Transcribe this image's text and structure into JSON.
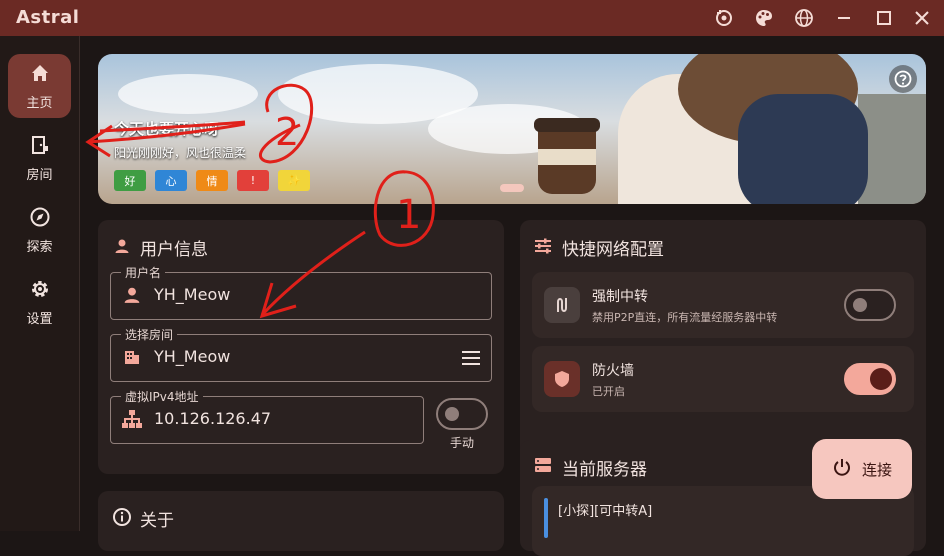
{
  "app": {
    "title": "Astral"
  },
  "titlebar_icons": [
    "sync-icon",
    "palette-icon",
    "globe-icon",
    "minimize-icon",
    "maximize-icon",
    "close-icon"
  ],
  "sidebar": {
    "items": [
      {
        "label": "主页",
        "icon": "home-icon",
        "active": true
      },
      {
        "label": "房间",
        "icon": "room-icon",
        "active": false
      },
      {
        "label": "探索",
        "icon": "compass-icon",
        "active": false
      },
      {
        "label": "设置",
        "icon": "gear-icon",
        "active": false
      }
    ]
  },
  "banner": {
    "title": "今天也要开心呀",
    "subtitle": "阳光刚刚好，风也很温柔",
    "chips": [
      {
        "text": "好",
        "color": "#3f9d43"
      },
      {
        "text": "心",
        "color": "#2f86d6"
      },
      {
        "text": "情",
        "color": "#ef8a16"
      },
      {
        "text": "!",
        "color": "#e2403a"
      },
      {
        "text": "✨",
        "color": "#f1d53a"
      }
    ]
  },
  "user_info": {
    "title": "用户信息",
    "username": {
      "label": "用户名",
      "value": "YH_Meow"
    },
    "room": {
      "label": "选择房间",
      "value": "YH_Meow"
    },
    "ipv4": {
      "label": "虚拟IPv4地址",
      "value": "10.126.126.47"
    },
    "manual_label": "手动"
  },
  "quick_config": {
    "title": "快捷网络配置",
    "options": [
      {
        "title": "强制中转",
        "desc": "禁用P2P直连，所有流量经服务器中转",
        "enabled": false
      },
      {
        "title": "防火墙",
        "desc": "已开启",
        "enabled": true
      }
    ]
  },
  "server": {
    "title": "当前服务器",
    "first_item": "[小探][可中转A]"
  },
  "about": {
    "title": "关于"
  },
  "connect": {
    "label": "连接"
  },
  "annotations": {
    "circle_1": "1",
    "circle_2": "2"
  },
  "colors": {
    "titlebar": "#6b2a24",
    "accent": "#f3a89b",
    "active_nav": "#7a3a33"
  }
}
